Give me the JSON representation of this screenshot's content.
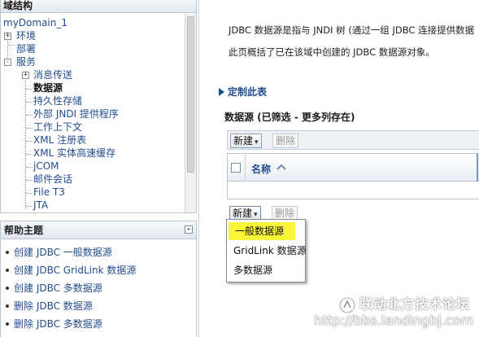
{
  "tree_panel": {
    "title": "域结构",
    "items": [
      {
        "label": "myDomain_1"
      },
      {
        "label": "环境",
        "toggle": "+"
      },
      {
        "label": "部署"
      },
      {
        "label": "服务",
        "toggle": "-"
      },
      {
        "label": "消息传送",
        "toggle": "+"
      },
      {
        "label": "数据源"
      },
      {
        "label": "持久性存储"
      },
      {
        "label": "外部 JNDI 提供程序"
      },
      {
        "label": "工作上下文"
      },
      {
        "label": "XML 注册表"
      },
      {
        "label": "XML 实体高速缓存"
      },
      {
        "label": "jCOM"
      },
      {
        "label": "邮件会话"
      },
      {
        "label": "File T3"
      },
      {
        "label": "JTA"
      }
    ]
  },
  "help_panel": {
    "title": "帮助主题",
    "collapse_glyph": "-",
    "links": [
      "创建 JDBC 一般数据源",
      "创建 JDBC GridLink 数据源",
      "创建 JDBC 多数据源",
      "删除 JDBC 数据源",
      "删除 JDBC 多数据源"
    ]
  },
  "main": {
    "description_1": "JDBC 数据源是指与 JNDI 树 (通过一组 JDBC 连接提供数据",
    "description_2": "此页概括了已在该域中创建的 JDBC 数据源对象。",
    "customize_label": "定制此表",
    "table_title": "数据源 (已筛选 - 更多列存在)",
    "toolbar": {
      "new_label": "新建",
      "delete_label": "删除"
    },
    "table": {
      "columns": [
        "名称"
      ]
    },
    "new_menu": {
      "items": [
        "一般数据源",
        "GridLink 数据源",
        "多数据源"
      ],
      "highlighted_index": 0
    }
  },
  "watermark": {
    "line1": "联动北方技术论坛",
    "line2": "http://bbs.landingbj.com"
  },
  "colors": {
    "link": "#234d8e",
    "highlight": "#fbf53a",
    "panel_border": "#b9c7d4"
  },
  "icons": [
    "plus-icon",
    "minus-icon",
    "triangle-right-icon",
    "chevron-down-icon",
    "sort-ascending-icon",
    "checkbox-icon"
  ]
}
